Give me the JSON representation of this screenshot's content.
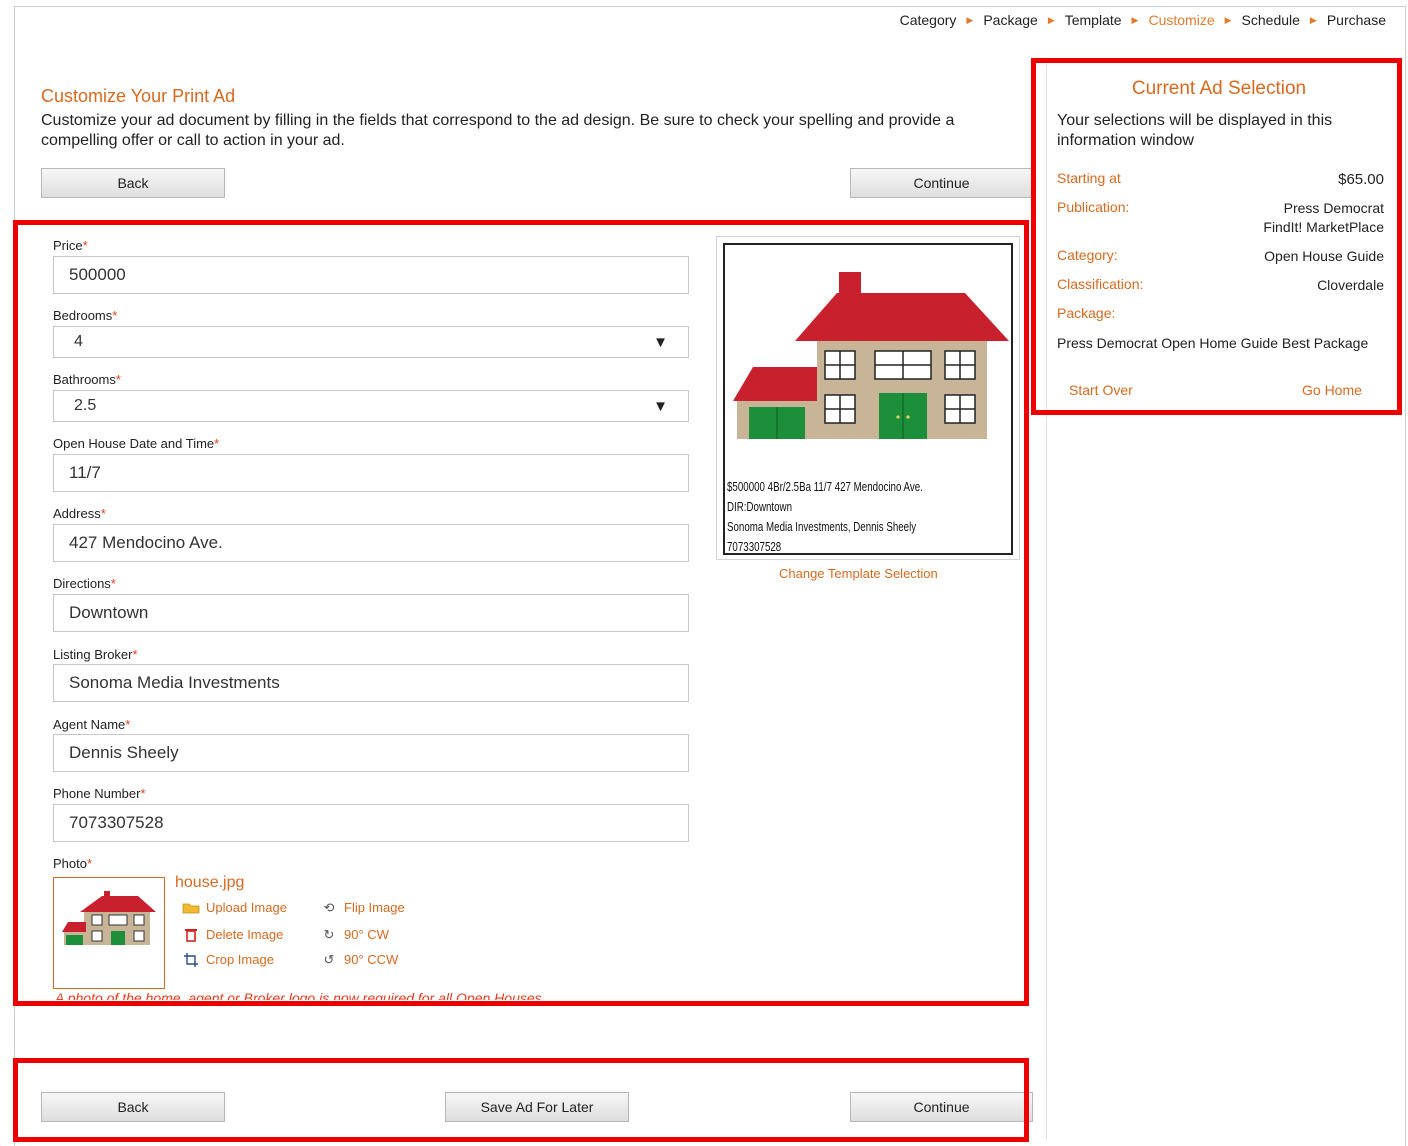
{
  "breadcrumb": {
    "steps": [
      "Category",
      "Package",
      "Template",
      "Customize",
      "Schedule",
      "Purchase"
    ],
    "active": "Customize"
  },
  "page": {
    "title": "Customize Your Print Ad",
    "intro": "Customize your ad document by filling in the fields that correspond to the ad design. Be sure to check your spelling and provide a compelling offer or call to action in your ad."
  },
  "buttons": {
    "back": "Back",
    "continue": "Continue",
    "save_for_later": "Save Ad For Later"
  },
  "form": {
    "price": {
      "label": "Price",
      "value": "500000"
    },
    "bedrooms": {
      "label": "Bedrooms",
      "value": "4"
    },
    "bathrooms": {
      "label": "Bathrooms",
      "value": "2.5"
    },
    "open_house": {
      "label": "Open House Date and Time",
      "value": "11/7"
    },
    "address": {
      "label": "Address",
      "value": "427 Mendocino Ave."
    },
    "directions": {
      "label": "Directions",
      "value": "Downtown"
    },
    "broker": {
      "label": "Listing Broker",
      "value": "Sonoma Media Investments"
    },
    "agent": {
      "label": "Agent Name",
      "value": "Dennis Sheely"
    },
    "phone": {
      "label": "Phone Number",
      "value": "7073307528"
    },
    "photo": {
      "label": "Photo",
      "filename": "house.jpg",
      "actions": {
        "upload": "Upload Image",
        "delete": "Delete Image",
        "crop": "Crop Image",
        "flip": "Flip Image",
        "cw": "90° CW",
        "ccw": "90° CCW"
      },
      "note": "A photo of the home, agent or Broker logo is now required for all Open Houses."
    },
    "required_mark": "*"
  },
  "template_preview": {
    "lines": [
      "$500000 4Br/2.5Ba 11/7 427 Mendocino Ave.",
      "DIR:Downtown",
      "Sonoma Media Investments, Dennis Sheely",
      "7073307528"
    ],
    "change_link": "Change Template Selection"
  },
  "sidebar": {
    "title": "Current Ad Selection",
    "intro": "Your selections will be displayed in this information window",
    "starting_label": "Starting at",
    "starting_value": "$65.00",
    "publication_label": "Publication:",
    "publication_value_1": "Press Democrat",
    "publication_value_2": "FindIt! MarketPlace",
    "category_label": "Category:",
    "category_value": "Open House Guide",
    "classification_label": "Classification:",
    "classification_value": "Cloverdale",
    "package_label": "Package:",
    "package_value": "Press Democrat Open Home Guide Best Package",
    "start_over": "Start Over",
    "go_home": "Go Home"
  },
  "colors": {
    "accent": "#d8691f",
    "highlight_box": "#ee0000",
    "required": "#e63c1e"
  }
}
